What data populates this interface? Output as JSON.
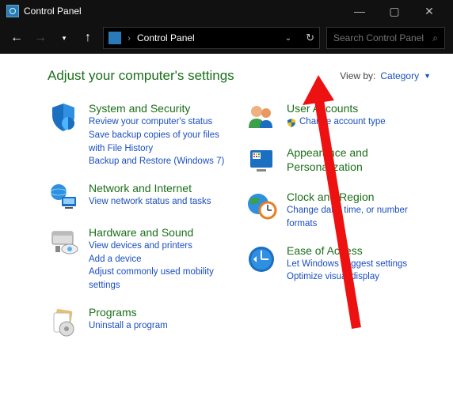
{
  "window": {
    "title": "Control Panel"
  },
  "nav": {
    "breadcrumb": "Control Panel",
    "search_placeholder": "Search Control Panel"
  },
  "header": {
    "heading": "Adjust your computer's settings",
    "viewby_label": "View by:",
    "viewby_value": "Category"
  },
  "left_col": [
    {
      "icon": "shield",
      "title": "System and Security",
      "links": [
        "Review your computer's status",
        "Save backup copies of your files with File History",
        "Backup and Restore (Windows 7)"
      ]
    },
    {
      "icon": "network",
      "title": "Network and Internet",
      "links": [
        "View network status and tasks"
      ]
    },
    {
      "icon": "hardware",
      "title": "Hardware and Sound",
      "links": [
        "View devices and printers",
        "Add a device",
        "Adjust commonly used mobility settings"
      ]
    },
    {
      "icon": "programs",
      "title": "Programs",
      "links": [
        "Uninstall a program"
      ]
    }
  ],
  "right_col": [
    {
      "icon": "users",
      "title": "User Accounts",
      "links": [
        "Change account type"
      ],
      "shield_on_first": true
    },
    {
      "icon": "appearance",
      "title": "Appearance and Personalization",
      "links": []
    },
    {
      "icon": "clock",
      "title": "Clock and Region",
      "links": [
        "Change date, time, or number formats"
      ]
    },
    {
      "icon": "ease",
      "title": "Ease of Access",
      "links": [
        "Let Windows suggest settings",
        "Optimize visual display"
      ]
    }
  ]
}
